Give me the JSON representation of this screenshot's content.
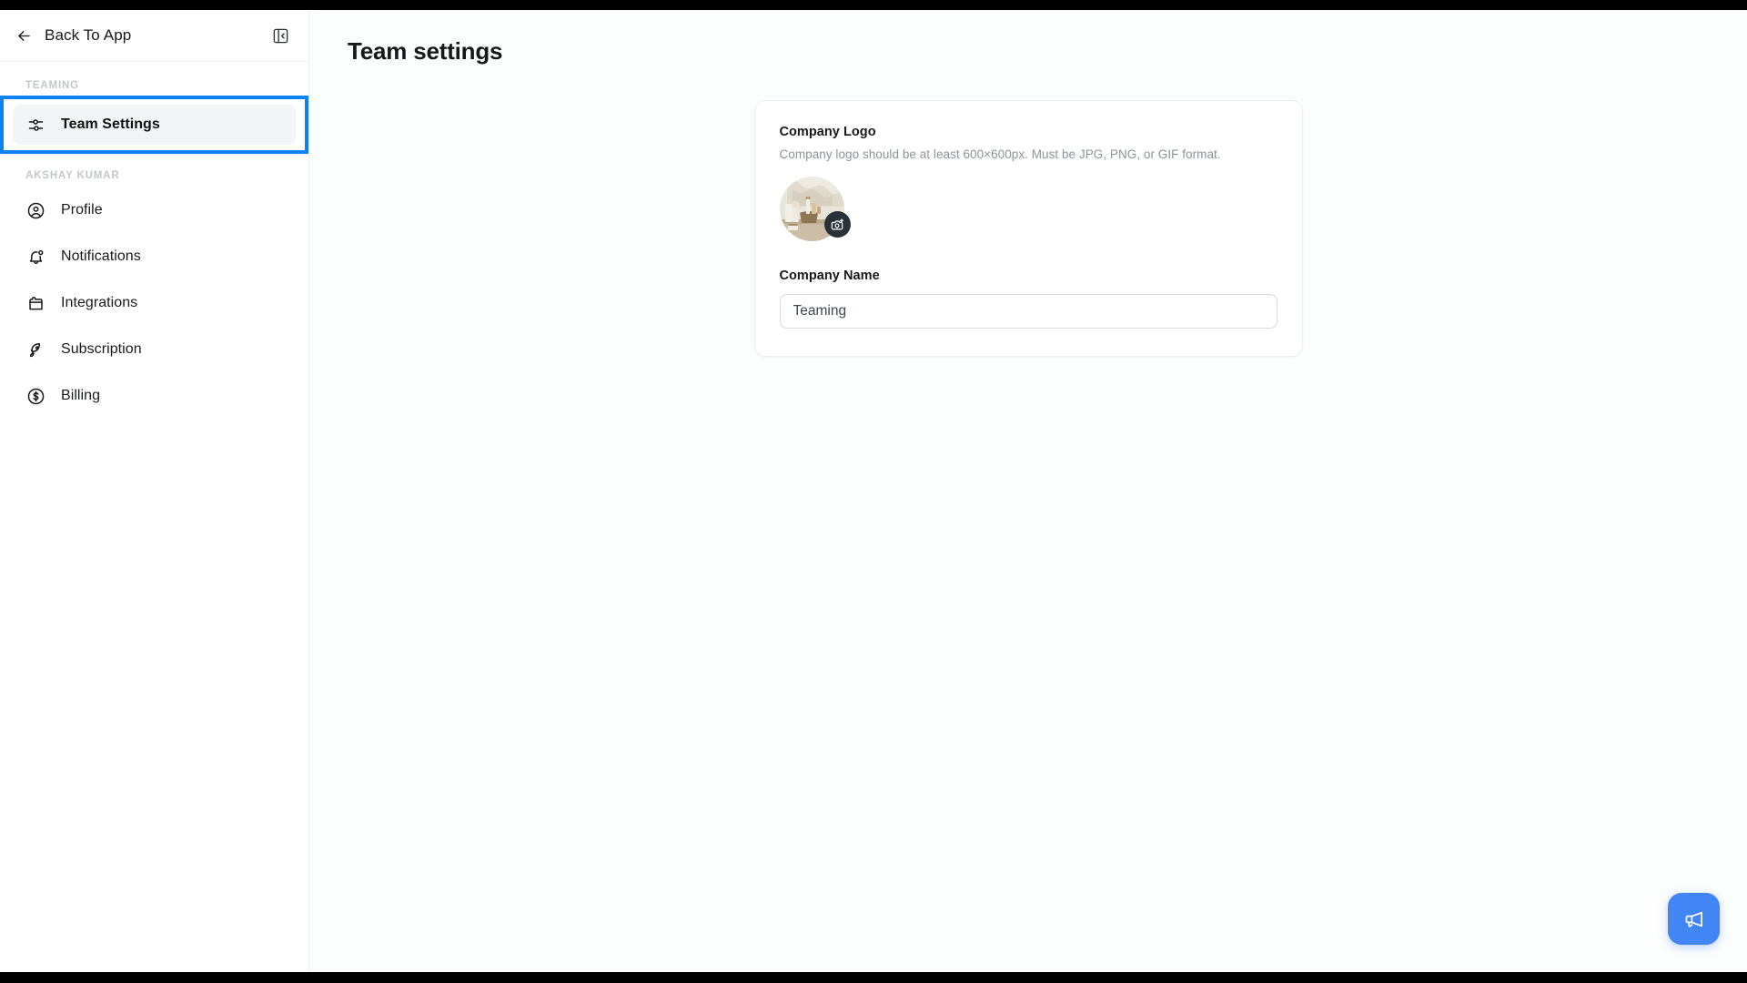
{
  "sidebar": {
    "back_link": {
      "label": "Back To App",
      "icon": "arrow-left-icon"
    },
    "collapse_button": {
      "icon": "panel-collapse-icon"
    },
    "sections": [
      {
        "label": "TEAMING",
        "items": [
          {
            "label": "Team Settings",
            "icon": "sliders-icon",
            "active": true
          }
        ]
      },
      {
        "label": "AKSHAY KUMAR",
        "items": [
          {
            "label": "Profile",
            "icon": "user-circle-icon",
            "active": false
          },
          {
            "label": "Notifications",
            "icon": "bell-icon",
            "active": false
          },
          {
            "label": "Integrations",
            "icon": "puzzle-icon",
            "active": false
          },
          {
            "label": "Subscription",
            "icon": "rocket-icon",
            "active": false
          },
          {
            "label": "Billing",
            "icon": "dollar-circle-icon",
            "active": false
          }
        ]
      }
    ]
  },
  "main": {
    "page_title": "Team settings",
    "card": {
      "logo": {
        "label": "Company Logo",
        "help": "Company logo should be at least 600×600px. Must be JPG, PNG, or GIF format.",
        "upload_icon": "camera-plus-icon"
      },
      "company_name": {
        "label": "Company Name",
        "value": "Teaming",
        "placeholder": "Company Name"
      }
    }
  },
  "floating_action": {
    "icon": "megaphone-icon",
    "color": "#4285f4"
  },
  "colors": {
    "accent": "#0b82f0",
    "fab": "#4285f4",
    "active_nav_bg": "#f2f4f5",
    "text_primary": "#17181a",
    "text_muted": "#8d939b",
    "section_label": "#c3c7cb",
    "page_bg": "#fcfdfd",
    "card_border": "#edeff1"
  }
}
